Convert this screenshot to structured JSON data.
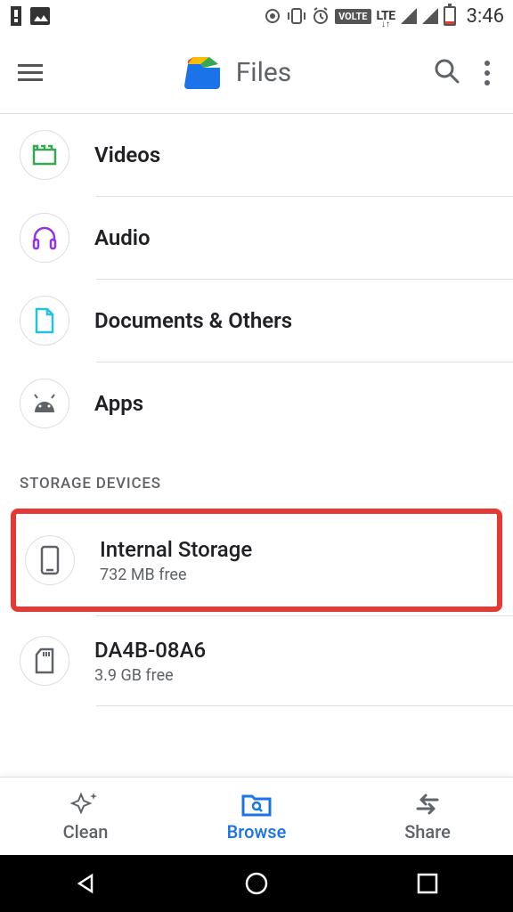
{
  "status_bar": {
    "time": "3:46",
    "volte": "VOLTE",
    "lte": "LTE"
  },
  "app_bar": {
    "title": "Files"
  },
  "categories": [
    {
      "id": "videos",
      "label": "Videos",
      "icon": "video-icon",
      "color": "#34a853"
    },
    {
      "id": "audio",
      "label": "Audio",
      "icon": "headphones-icon",
      "color": "#9334e6"
    },
    {
      "id": "documents",
      "label": "Documents & Others",
      "icon": "document-icon",
      "color": "#24c1e0"
    },
    {
      "id": "apps",
      "label": "Apps",
      "icon": "android-icon",
      "color": "#5f6368"
    }
  ],
  "section_header": "STORAGE DEVICES",
  "storage": [
    {
      "id": "internal",
      "title": "Internal Storage",
      "subtitle": "732 MB free",
      "icon": "phone-icon",
      "highlighted": true
    },
    {
      "id": "sd",
      "title": "DA4B-08A6",
      "subtitle": "3.9 GB free",
      "icon": "sd-card-icon",
      "highlighted": false
    }
  ],
  "bottom_nav": [
    {
      "id": "clean",
      "label": "Clean",
      "icon": "sparkle-icon",
      "active": false
    },
    {
      "id": "browse",
      "label": "Browse",
      "icon": "folder-search-icon",
      "active": true
    },
    {
      "id": "share",
      "label": "Share",
      "icon": "swap-icon",
      "active": false
    }
  ]
}
